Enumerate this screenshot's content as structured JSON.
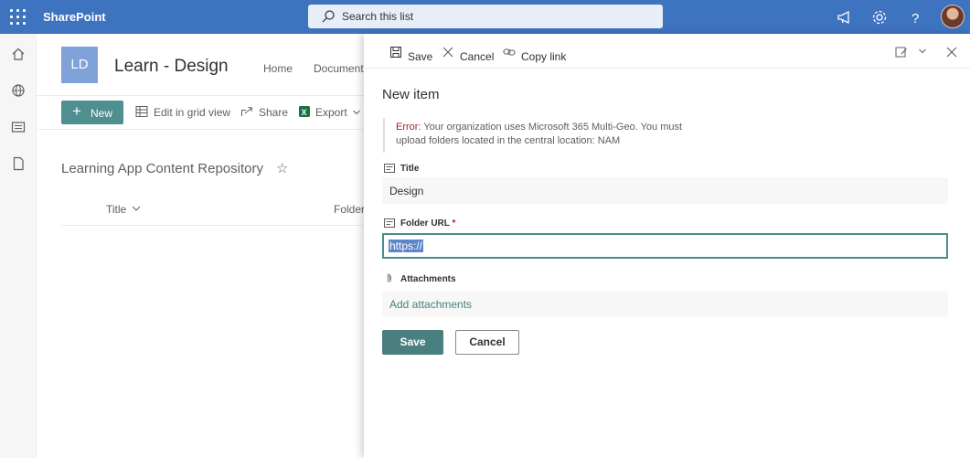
{
  "suite": {
    "brand": "SharePoint",
    "search_placeholder": "Search this list"
  },
  "site": {
    "logo_initials": "LD",
    "title": "Learn - Design",
    "nav": [
      "Home",
      "Documents"
    ]
  },
  "commandbar": {
    "new_label": "New",
    "edit_grid_label": "Edit in grid view",
    "share_label": "Share",
    "export_label": "Export"
  },
  "list": {
    "title": "Learning App Content Repository",
    "columns": [
      "Title",
      "Folder"
    ]
  },
  "panel": {
    "toolbar": {
      "save_label": "Save",
      "cancel_label": "Cancel",
      "copy_link_label": "Copy link"
    },
    "title": "New item",
    "error_prefix": "Error:",
    "error_message": "Your organization uses Microsoft 365 Multi-Geo. You must upload folders located in the central location: NAM",
    "fields": {
      "title_label": "Title",
      "title_value": "Design",
      "folder_url_label": "Folder URL",
      "folder_url_required": "*",
      "folder_url_value": "https://",
      "attachments_label": "Attachments",
      "attachments_action": "Add attachments"
    },
    "buttons": {
      "save_label": "Save",
      "cancel_label": "Cancel"
    }
  },
  "colors": {
    "suitebar": "#3e73c0",
    "accent": "#4a7f7f",
    "error": "#a4262c",
    "site_logo": "#7fa2d9"
  }
}
